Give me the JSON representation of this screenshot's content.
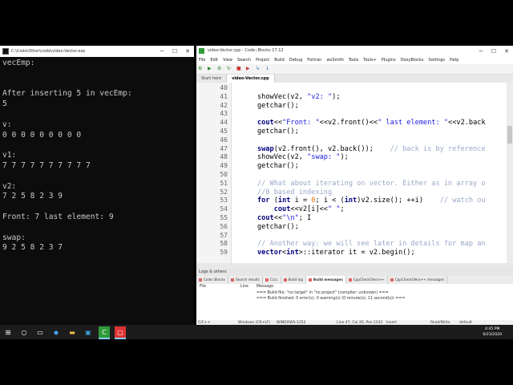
{
  "console": {
    "title": "C:\\Code\\Other\\code\\video-Vector.exe",
    "output": "vecEmp:\n\n\nAfter inserting 5 in vecEmp:\n5\n\nv:\n0 0 0 0 0 0 0 0 0\n\nv1:\n7 7 7 7 7 7 7 7 7 7\n\nv2:\n7 2 5 8 2 3 9\n\nFront: 7 last element: 9\n\nswap:\n9 2 5 8 2 3 7"
  },
  "codeblocks": {
    "title": "video-Vector.cpp - Code::Blocks 17.12",
    "menu": [
      "File",
      "Edit",
      "View",
      "Search",
      "Project",
      "Build",
      "Debug",
      "Fortran",
      "wxSmith",
      "Tools",
      "Tools+",
      "Plugins",
      "DoxyBlocks",
      "Settings",
      "Help"
    ],
    "tabs": [
      "Start here",
      "video-Vector.cpp"
    ],
    "lines": [
      {
        "n": "40",
        "parts": []
      },
      {
        "n": "41",
        "parts": [
          {
            "t": "showVec(v2, ",
            "c": "#000"
          },
          {
            "t": "\"v2: \"",
            "c": "#1a1adf"
          },
          {
            "t": ");",
            "c": "#000"
          }
        ]
      },
      {
        "n": "42",
        "parts": [
          {
            "t": "getchar();",
            "c": "#000"
          }
        ]
      },
      {
        "n": "43",
        "parts": []
      },
      {
        "n": "44",
        "parts": [
          {
            "t": "cout",
            "c": "#000080",
            "b": true
          },
          {
            "t": "<<",
            "c": "#000"
          },
          {
            "t": "\"Front: \"",
            "c": "#1a1adf"
          },
          {
            "t": "<<v2.front()<<",
            "c": "#000"
          },
          {
            "t": "\" last element: \"",
            "c": "#1a1adf"
          },
          {
            "t": "<<v2.back",
            "c": "#000"
          }
        ]
      },
      {
        "n": "45",
        "parts": [
          {
            "t": "getchar();",
            "c": "#000"
          }
        ]
      },
      {
        "n": "46",
        "parts": []
      },
      {
        "n": "47",
        "parts": [
          {
            "t": "swap",
            "c": "#000080",
            "b": true
          },
          {
            "t": "(v2.front(), v2.back());    ",
            "c": "#000"
          },
          {
            "t": "// back is by reference",
            "c": "#9aa8c8"
          }
        ]
      },
      {
        "n": "48",
        "parts": [
          {
            "t": "showVec(v2, ",
            "c": "#000"
          },
          {
            "t": "\"swap: \"",
            "c": "#1a1adf"
          },
          {
            "t": ");",
            "c": "#000"
          }
        ]
      },
      {
        "n": "49",
        "parts": [
          {
            "t": "getchar();",
            "c": "#000"
          }
        ]
      },
      {
        "n": "50",
        "parts": []
      },
      {
        "n": "51",
        "parts": [
          {
            "t": "// What about iterating on vector. Either as in array o",
            "c": "#9aa8c8"
          }
        ]
      },
      {
        "n": "52",
        "parts": [
          {
            "t": "//0 based indexing",
            "c": "#9aa8c8"
          }
        ]
      },
      {
        "n": "53",
        "parts": [
          {
            "t": "for",
            "c": "#000080",
            "b": true
          },
          {
            "t": " (",
            "c": "#000"
          },
          {
            "t": "int",
            "c": "#000080",
            "b": true
          },
          {
            "t": " i = ",
            "c": "#000"
          },
          {
            "t": "0",
            "c": "#e07000"
          },
          {
            "t": "; i < (",
            "c": "#000"
          },
          {
            "t": "int",
            "c": "#000080",
            "b": true
          },
          {
            "t": ")v2.size(); ++i)    ",
            "c": "#000"
          },
          {
            "t": "// watch ou",
            "c": "#9aa8c8"
          }
        ]
      },
      {
        "n": "54",
        "parts": [
          {
            "t": "    cout",
            "c": "#000080",
            "b": true
          },
          {
            "t": "<<v2[i]<<",
            "c": "#000"
          },
          {
            "t": "\" \"",
            "c": "#1a1adf"
          },
          {
            "t": ";",
            "c": "#000"
          }
        ]
      },
      {
        "n": "55",
        "parts": [
          {
            "t": "cout",
            "c": "#000080",
            "b": true
          },
          {
            "t": "<<",
            "c": "#000"
          },
          {
            "t": "\"\\n\"",
            "c": "#1a1adf"
          },
          {
            "t": "; ",
            "c": "#000"
          },
          {
            "t": "I",
            "c": "#000"
          }
        ]
      },
      {
        "n": "56",
        "parts": [
          {
            "t": "getchar();",
            "c": "#000"
          }
        ]
      },
      {
        "n": "57",
        "parts": []
      },
      {
        "n": "58",
        "parts": [
          {
            "t": "// Another way: we will see later in details for map an",
            "c": "#9aa8c8"
          }
        ]
      },
      {
        "n": "59",
        "parts": [
          {
            "t": "vector",
            "c": "#000080",
            "b": true
          },
          {
            "t": "<",
            "c": "#000"
          },
          {
            "t": "int",
            "c": "#000080",
            "b": true
          },
          {
            "t": ">::iterator it = v2.begin()",
            "c": "#000"
          },
          {
            "t": ";",
            "c": "#000"
          }
        ]
      }
    ],
    "logs_title": "Logs & others",
    "log_tabs": [
      "Code::Blocks",
      "Search results",
      "Cccc",
      "Build log",
      "Build messages",
      "CppCheck/Vera++",
      "CppCheck/Vera++ messages"
    ],
    "log_active": "Build messages",
    "log_headers": {
      "file": "File",
      "line": "Line",
      "message": "Message"
    },
    "log_messages": [
      "=== Build file: \"no target\" in \"no project\" (compiler: unknown) ===",
      "=== Build finished: 0 error(s), 0 warning(s) (0 minute(s), 11 second(s)) ==="
    ],
    "status": {
      "lang": "C/C++",
      "eol": "Windows (CR+LF)",
      "encoding": "WINDOWS-1252",
      "pos": "Line 47, Col 26, Pos 1143",
      "mode": "Insert",
      "rw": "Read/Write",
      "profile": "default"
    }
  },
  "taskbar": {
    "time": "4:45 PM",
    "date": "6/23/2020"
  }
}
